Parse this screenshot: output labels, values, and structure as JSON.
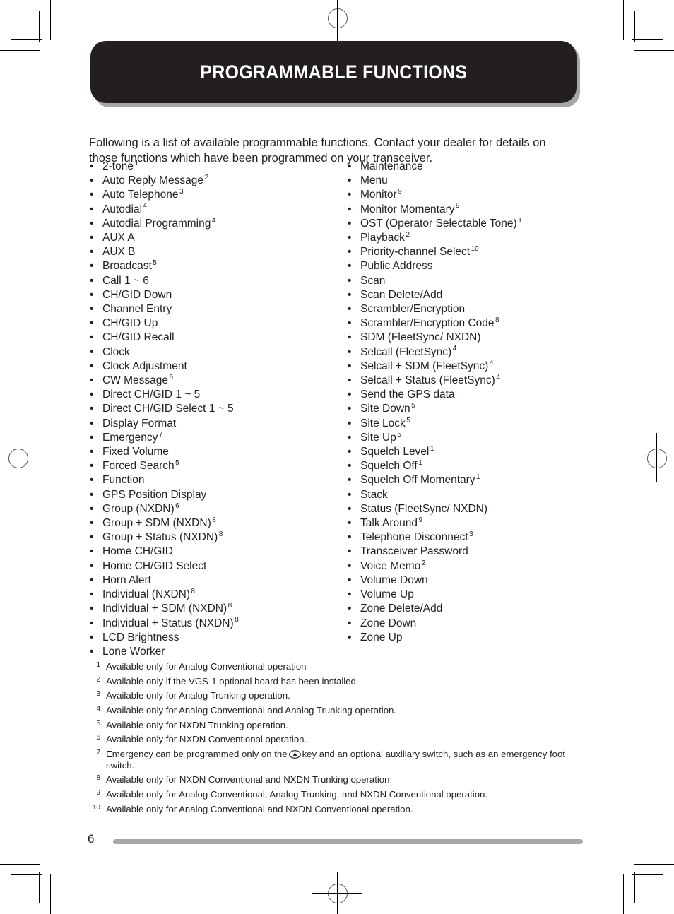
{
  "header": {
    "title": "PROGRAMMABLE FUNCTIONS",
    "background_color": "#231f20",
    "text_color": "#ffffff",
    "shadow_color": "#a7a6a6"
  },
  "intro": {
    "text": "Following is a list of available programmable functions.  Contact your dealer for details on those functions which have been programmed on your transceiver."
  },
  "bullet_glyph": "•",
  "columns": {
    "left": [
      {
        "label": "2-tone",
        "note": "1"
      },
      {
        "label": "Auto Reply Message",
        "note": "2"
      },
      {
        "label": "Auto Telephone",
        "note": "3"
      },
      {
        "label": "Autodial",
        "note": "4"
      },
      {
        "label": "Autodial Programming",
        "note": "4"
      },
      {
        "label": "AUX A",
        "note": ""
      },
      {
        "label": "AUX B",
        "note": ""
      },
      {
        "label": "Broadcast",
        "note": "5"
      },
      {
        "label": "Call 1 ~ 6",
        "note": ""
      },
      {
        "label": "CH/GID Down",
        "note": ""
      },
      {
        "label": "Channel Entry",
        "note": ""
      },
      {
        "label": "CH/GID Up",
        "note": ""
      },
      {
        "label": "CH/GID Recall",
        "note": ""
      },
      {
        "label": "Clock",
        "note": ""
      },
      {
        "label": "Clock Adjustment",
        "note": ""
      },
      {
        "label": "CW Message",
        "note": "6"
      },
      {
        "label": "Direct CH/GID 1 ~ 5",
        "note": ""
      },
      {
        "label": "Direct CH/GID Select 1 ~ 5",
        "note": ""
      },
      {
        "label": "Display Format",
        "note": ""
      },
      {
        "label": "Emergency",
        "note": "7"
      },
      {
        "label": "Fixed Volume",
        "note": ""
      },
      {
        "label": "Forced Search",
        "note": "5"
      },
      {
        "label": "Function",
        "note": ""
      },
      {
        "label": "GPS Position Display",
        "note": ""
      },
      {
        "label": "Group (NXDN)",
        "note": "6"
      },
      {
        "label": "Group + SDM (NXDN)",
        "note": "8"
      },
      {
        "label": "Group + Status (NXDN)",
        "note": "8"
      },
      {
        "label": "Home CH/GID",
        "note": ""
      },
      {
        "label": "Home CH/GID Select",
        "note": ""
      },
      {
        "label": "Horn Alert",
        "note": ""
      },
      {
        "label": "Individual (NXDN)",
        "note": "8"
      },
      {
        "label": "Individual + SDM (NXDN)",
        "note": "8"
      },
      {
        "label": "Individual + Status (NXDN)",
        "note": "8"
      },
      {
        "label": "LCD Brightness",
        "note": ""
      },
      {
        "label": "Lone Worker",
        "note": ""
      }
    ],
    "right": [
      {
        "label": "Maintenance",
        "note": ""
      },
      {
        "label": "Menu",
        "note": ""
      },
      {
        "label": "Monitor",
        "note": "9"
      },
      {
        "label": "Monitor Momentary",
        "note": "9"
      },
      {
        "label": "OST (Operator Selectable Tone)",
        "note": "1"
      },
      {
        "label": "Playback",
        "note": "2"
      },
      {
        "label": "Priority-channel Select",
        "note": "10"
      },
      {
        "label": "Public Address",
        "note": ""
      },
      {
        "label": "Scan",
        "note": ""
      },
      {
        "label": "Scan Delete/Add",
        "note": ""
      },
      {
        "label": "Scrambler/Encryption",
        "note": ""
      },
      {
        "label": "Scrambler/Encryption Code",
        "note": "8"
      },
      {
        "label": "SDM (FleetSync/ NXDN)",
        "note": ""
      },
      {
        "label": "Selcall (FleetSync)",
        "note": "4"
      },
      {
        "label": "Selcall + SDM (FleetSync)",
        "note": "4"
      },
      {
        "label": "Selcall + Status (FleetSync)",
        "note": "4"
      },
      {
        "label": "Send the GPS data",
        "note": ""
      },
      {
        "label": "Site Down",
        "note": "5"
      },
      {
        "label": "Site Lock",
        "note": "5"
      },
      {
        "label": "Site Up",
        "note": "5"
      },
      {
        "label": "Squelch Level",
        "note": "1"
      },
      {
        "label": "Squelch Off",
        "note": "1"
      },
      {
        "label": "Squelch Off Momentary",
        "note": "1"
      },
      {
        "label": "Stack",
        "note": ""
      },
      {
        "label": "Status (FleetSync/ NXDN)",
        "note": ""
      },
      {
        "label": "Talk Around",
        "note": "9"
      },
      {
        "label": "Telephone Disconnect",
        "note": "3"
      },
      {
        "label": "Transceiver Password",
        "note": ""
      },
      {
        "label": "Voice Memo",
        "note": "2"
      },
      {
        "label": "Volume Down",
        "note": ""
      },
      {
        "label": "Volume Up",
        "note": ""
      },
      {
        "label": "Zone Delete/Add",
        "note": ""
      },
      {
        "label": "Zone Down",
        "note": ""
      },
      {
        "label": "Zone Up",
        "note": ""
      }
    ]
  },
  "footnotes": [
    {
      "num": "1",
      "text": "Available only for Analog Conventional operation"
    },
    {
      "num": "2",
      "text": "Available only if the VGS-1 optional board has been installed."
    },
    {
      "num": "3",
      "text": "Available only for Analog Trunking operation."
    },
    {
      "num": "4",
      "text": "Available only for Analog Conventional and Analog Trunking operation."
    },
    {
      "num": "5",
      "text": "Available only for NXDN Trunking operation."
    },
    {
      "num": "6",
      "text": "Available only for NXDN Conventional operation."
    },
    {
      "num": "7",
      "text_before_icon": "Emergency can be programmed only on the",
      "icon": "emergency-key-icon",
      "text_after_icon": "key and an optional auxiliary switch, such as an emergency foot switch."
    },
    {
      "num": "8",
      "text": "Available only for NXDN Conventional and NXDN Trunking operation."
    },
    {
      "num": "9",
      "text": "Available only for Analog Conventional, Analog Trunking, and NXDN Conventional operation."
    },
    {
      "num": "10",
      "text": "Available only for Analog Conventional and NXDN Conventional operation."
    }
  ],
  "footer": {
    "page_number": "6",
    "rule_color": "#a9a8a8"
  }
}
